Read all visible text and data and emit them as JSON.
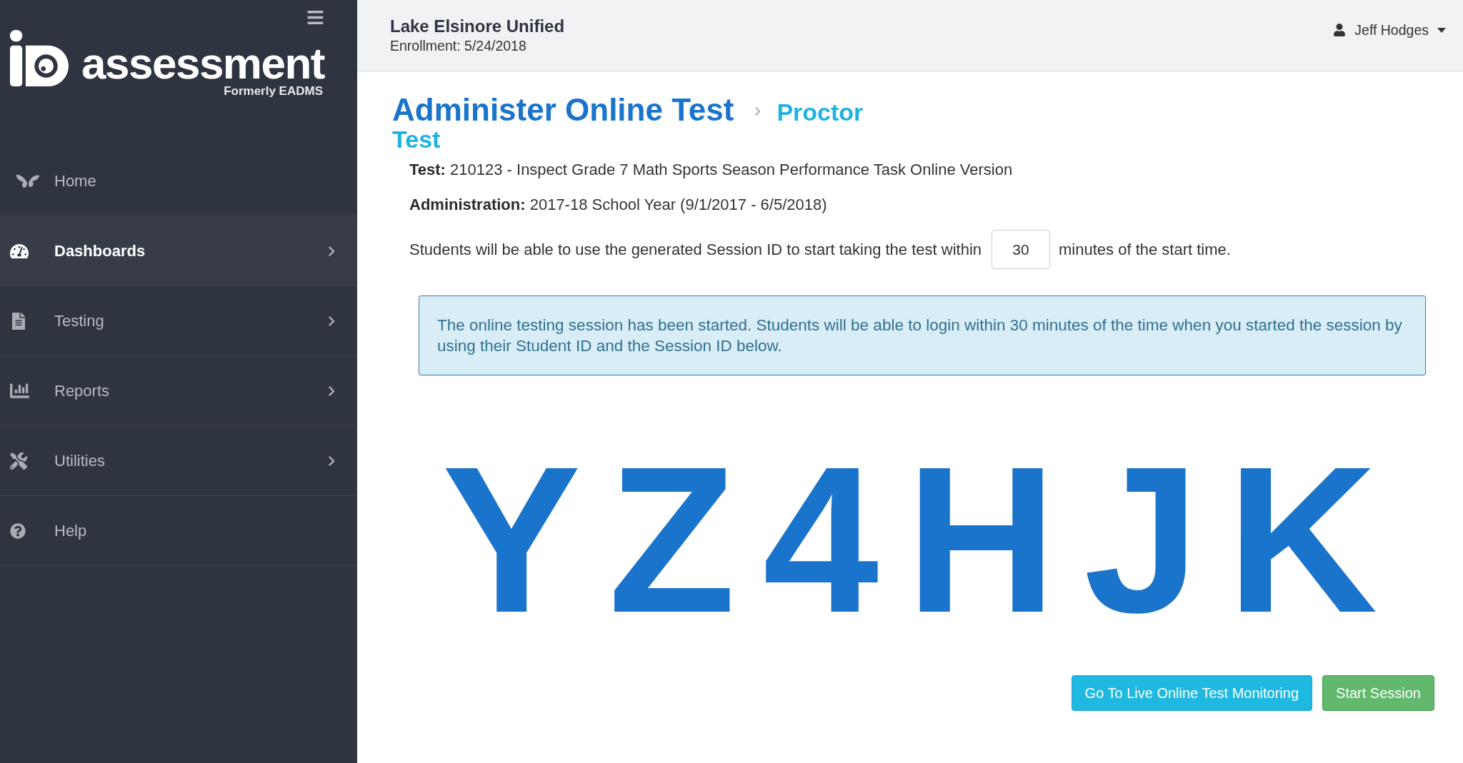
{
  "sidebar": {
    "logo": {
      "wordmark": "assessment",
      "tagline": "Formerly EADMS"
    },
    "items": [
      {
        "label": "Home",
        "selected": false,
        "expandable": false
      },
      {
        "label": "Dashboards",
        "selected": true,
        "expandable": true
      },
      {
        "label": "Testing",
        "selected": false,
        "expandable": true
      },
      {
        "label": "Reports",
        "selected": false,
        "expandable": true
      },
      {
        "label": "Utilities",
        "selected": false,
        "expandable": true
      },
      {
        "label": "Help",
        "selected": false,
        "expandable": false
      }
    ]
  },
  "header": {
    "district": "Lake Elsinore Unified",
    "enrollment": "Enrollment: 5/24/2018",
    "user": "Jeff Hodges"
  },
  "page": {
    "title": "Administer Online Test",
    "subtitle_lines": [
      "Proctor",
      "Test"
    ]
  },
  "details": [
    "**Test:** 210123 - Inspect Grade 7 Math Sports Season Performance Task Online Version",
    "**Administration:** 2017-18 School Year (9/1/2017 - 6/5/2018)"
  ],
  "session_window": {
    "before": "Students will be able to use the generated Session ID to start taking the test within",
    "minutes": "30",
    "after": "minutes of the start time."
  },
  "alert": {
    "text": "The online testing session has been started. Students will be able to login within 30 minutes of the time when you started the session by using their Student ID and the Session ID below."
  },
  "session_id": "YZ4HJK",
  "buttons": [
    {
      "label": "Go To Live Online Test Monitoring",
      "kind": "info"
    },
    {
      "label": "Start Session",
      "kind": "success"
    }
  ]
}
